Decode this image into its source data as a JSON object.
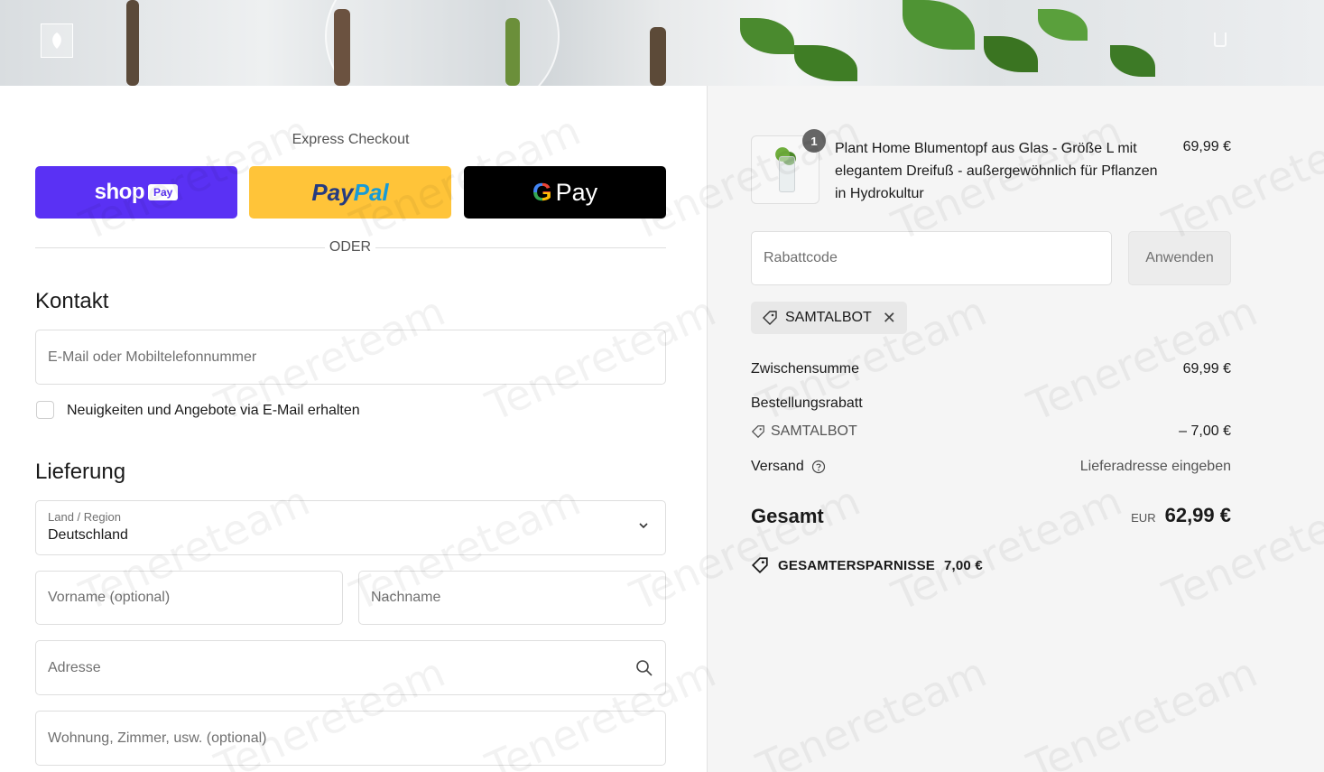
{
  "banner": {
    "logo_icon": "leaf-logo-icon",
    "cart_icon": "cart-icon"
  },
  "express": {
    "title": "Express Checkout",
    "shop_pay": {
      "word": "shop",
      "badge": "Pay",
      "color": "#5a31f4"
    },
    "paypal": {
      "part1": "Pay",
      "part2": "Pal",
      "color": "#ffc439"
    },
    "gpay": {
      "g": "G",
      "word": "Pay",
      "color": "#000000"
    },
    "divider_label": "ODER"
  },
  "contact": {
    "heading": "Kontakt",
    "email_placeholder": "E-Mail oder Mobiltelefonnummer",
    "newsletter_label": "Neuigkeiten und Angebote via E-Mail erhalten",
    "newsletter_checked": false
  },
  "delivery": {
    "heading": "Lieferung",
    "country_label": "Land / Region",
    "country_value": "Deutschland",
    "first_name_placeholder": "Vorname (optional)",
    "last_name_placeholder": "Nachname",
    "address_placeholder": "Adresse",
    "apartment_placeholder": "Wohnung, Zimmer, usw. (optional)"
  },
  "summary": {
    "product": {
      "quantity": "1",
      "name": "Plant Home Blumentopf aus Glas - Größe L mit elegantem Dreifuß - außergewöhnlich für Pflanzen in Hydrokultur",
      "price": "69,99 €"
    },
    "discount_placeholder": "Rabattcode",
    "apply_label": "Anwenden",
    "applied_code": "SAMTALBOT",
    "subtotal_label": "Zwischensumme",
    "subtotal_value": "69,99 €",
    "order_discount_label": "Bestellungsrabatt",
    "order_discount_code": "SAMTALBOT",
    "order_discount_value": "– 7,00 €",
    "shipping_label": "Versand",
    "shipping_value": "Lieferadresse eingeben",
    "total_label": "Gesamt",
    "total_currency": "EUR",
    "total_value": "62,99 €",
    "savings_label": "GESAMTERSPARNISSE",
    "savings_value": "7,00 €"
  },
  "watermark": "Tenereteam"
}
